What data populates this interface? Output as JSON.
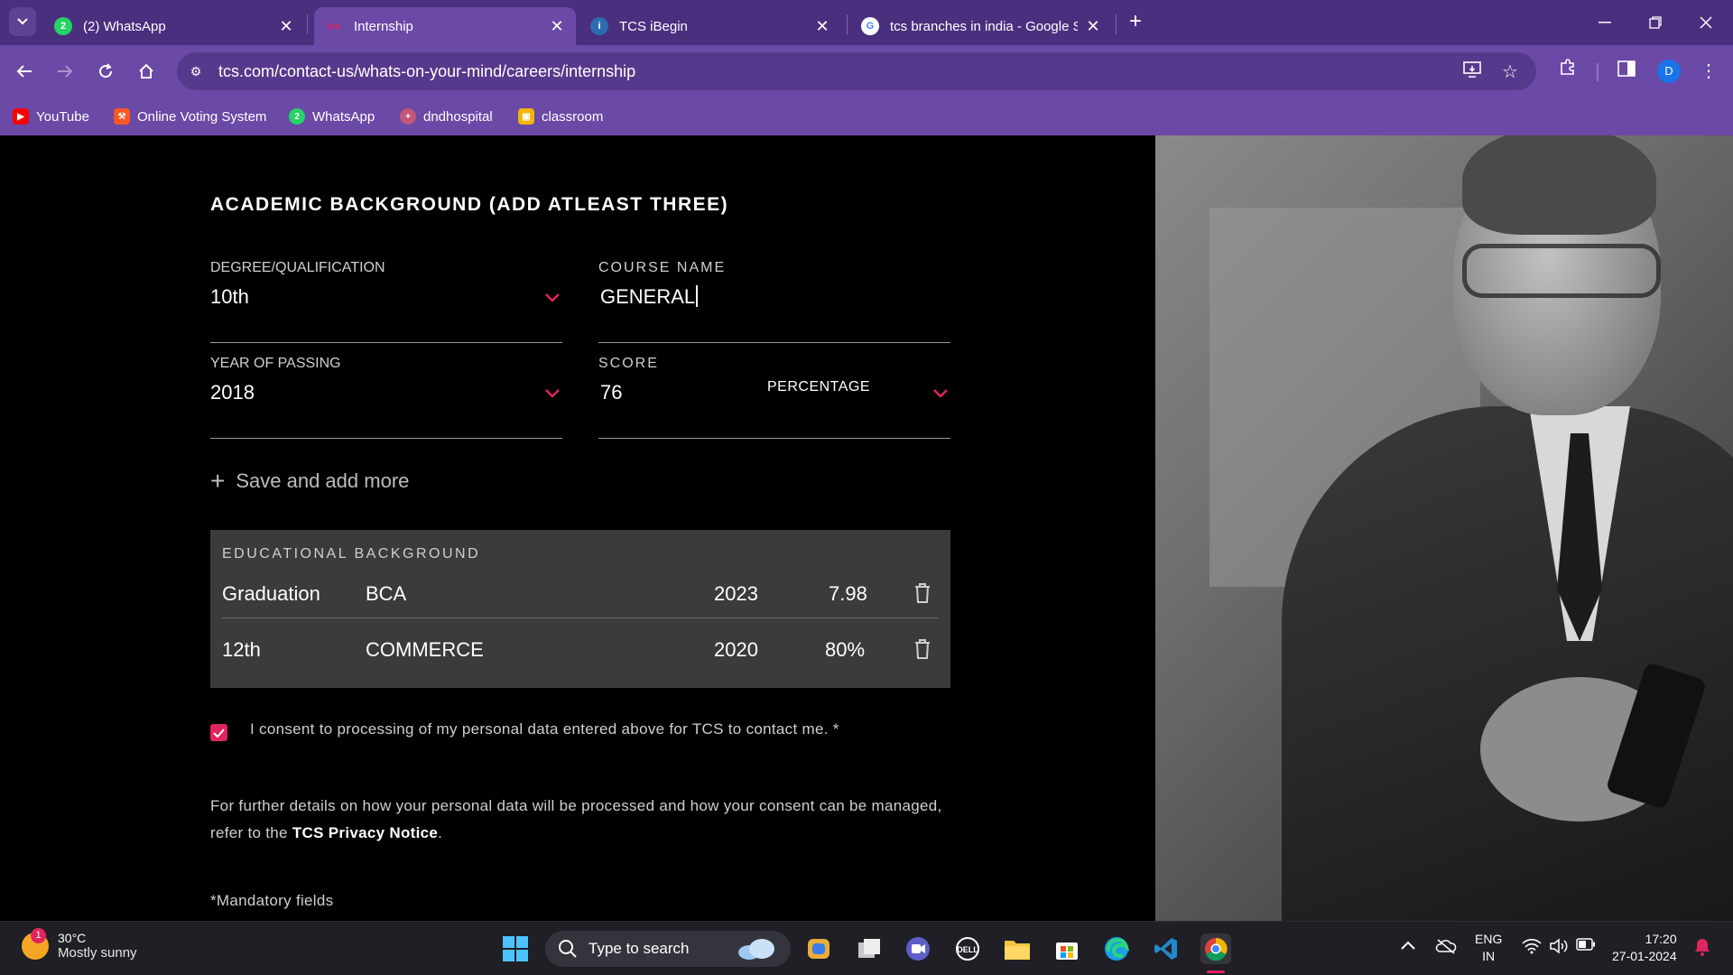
{
  "browser": {
    "tabs": [
      {
        "title": "(2) WhatsApp",
        "favicon": "whatsapp-icon",
        "active": false
      },
      {
        "title": "Internship",
        "favicon": "tcs-icon",
        "active": true
      },
      {
        "title": "TCS iBegin",
        "favicon": "ibegin-icon",
        "active": false
      },
      {
        "title": "tcs branches in india - Google S",
        "favicon": "google-icon",
        "active": false
      }
    ],
    "url": "tcs.com/contact-us/whats-on-your-mind/careers/internship",
    "profile_initial": "D",
    "bookmarks": [
      {
        "label": "YouTube",
        "icon": "youtube-icon"
      },
      {
        "label": "Online Voting System",
        "icon": "voting-icon"
      },
      {
        "label": "WhatsApp",
        "icon": "whatsapp-icon"
      },
      {
        "label": "dndhospital",
        "icon": "hospital-icon"
      },
      {
        "label": "classroom",
        "icon": "classroom-icon"
      }
    ]
  },
  "form": {
    "section_title": "ACADEMIC BACKGROUND (ADD ATLEAST THREE)",
    "degree": {
      "label": "DEGREE/QUALIFICATION",
      "value": "10th"
    },
    "course": {
      "label": "COURSE NAME",
      "value": "GENERAL"
    },
    "year": {
      "label": "YEAR OF PASSING",
      "value": "2018"
    },
    "score": {
      "label": "SCORE",
      "value": "76",
      "unit": "PERCENTAGE"
    },
    "add_more": "Save and add more",
    "edu_title": "EDUCATIONAL BACKGROUND",
    "edu_rows": [
      {
        "degree": "Graduation",
        "course": "BCA",
        "year": "2023",
        "score": "7.98"
      },
      {
        "degree": "12th",
        "course": "COMMERCE",
        "year": "2020",
        "score": "80%"
      }
    ],
    "consent": "I consent to processing of my personal data entered above for TCS to contact me. *",
    "consent_checked": true,
    "notice_before": "For further details on how your personal data will be processed and how your consent can be managed, refer to the ",
    "notice_link": "TCS Privacy Notice",
    "notice_after": ".",
    "mandatory": "*Mandatory fields"
  },
  "taskbar": {
    "weather_temp": "30°C",
    "weather_desc": "Mostly sunny",
    "weather_badge": "1",
    "search_placeholder": "Type to search",
    "lang_1": "ENG",
    "lang_2": "IN",
    "time": "17:20",
    "date": "27-01-2024"
  },
  "colors": {
    "accent": "#e0245e",
    "tabbar": "#4a2f7e",
    "toolbar": "#6b49a6",
    "edu_box": "#3a3b3d"
  }
}
